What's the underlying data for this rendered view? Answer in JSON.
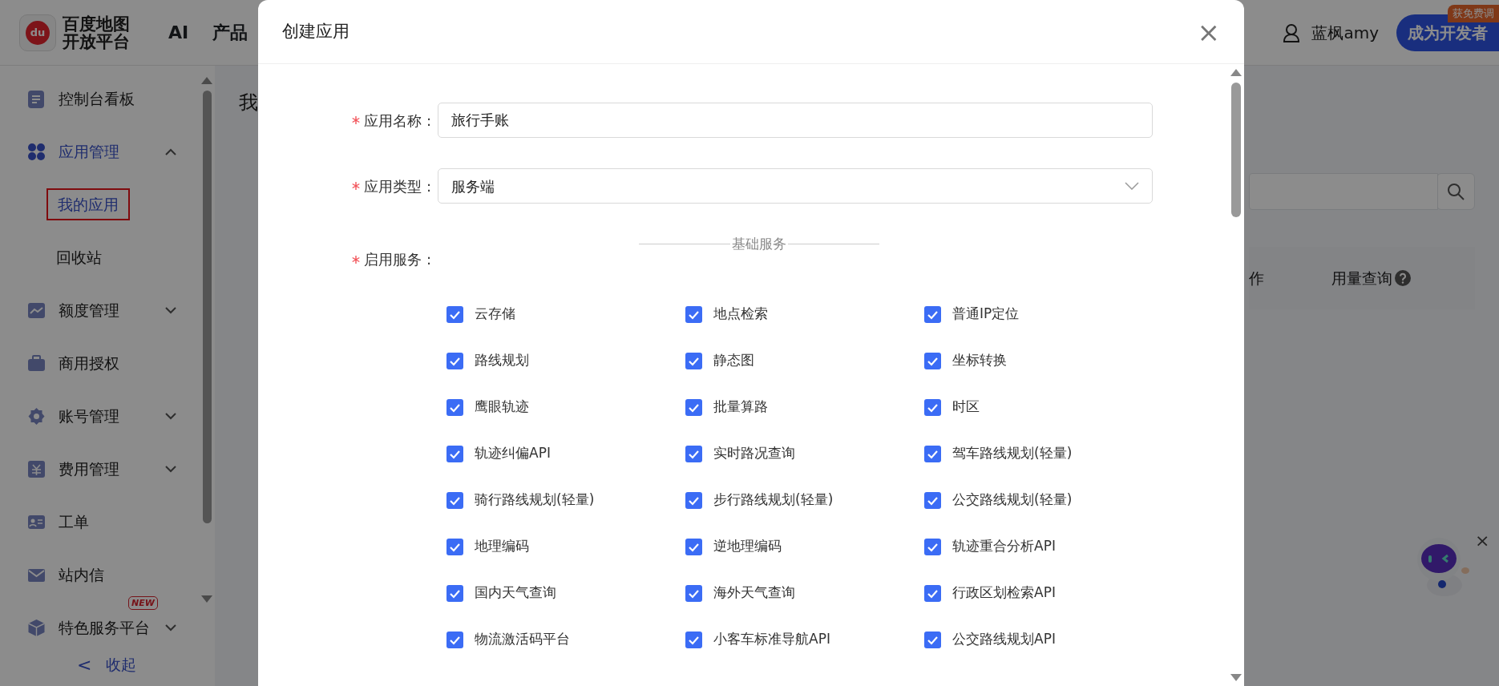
{
  "header": {
    "logo_mark": "du",
    "logo_lines": [
      "百度地图",
      "开放平台"
    ],
    "nav": [
      "AI",
      "产品"
    ],
    "user": "蓝枫amy",
    "cta": "成为开发者",
    "promo": "获免费调"
  },
  "sidebar": {
    "items": [
      {
        "label": "控制台看板",
        "selected": false
      },
      {
        "label": "应用管理",
        "selected": true,
        "expanded": true,
        "children": [
          {
            "label": "我的应用",
            "selected": true
          },
          {
            "label": "回收站",
            "selected": false
          }
        ]
      },
      {
        "label": "额度管理",
        "selected": false,
        "expanded": false
      },
      {
        "label": "商用授权",
        "selected": false
      },
      {
        "label": "账号管理",
        "selected": false,
        "expanded": false
      },
      {
        "label": "费用管理",
        "selected": false,
        "expanded": false
      },
      {
        "label": "工单",
        "selected": false
      },
      {
        "label": "站内信",
        "selected": false
      },
      {
        "label": "特色服务平台",
        "selected": false,
        "expanded": false,
        "badge": "NEW"
      }
    ],
    "collapse": {
      "arrow": "<",
      "label": "收起"
    }
  },
  "page": {
    "title": "我",
    "columns": [
      "作",
      "用量查询"
    ]
  },
  "modal": {
    "title": "创建应用",
    "close": "×",
    "fields": [
      {
        "label": "应用名称 :",
        "required": true,
        "kind": "text",
        "value": "旅行手账"
      },
      {
        "label": "应用类型 :",
        "required": true,
        "kind": "select",
        "value": "服务端"
      }
    ],
    "services": {
      "label": "启用服务 :",
      "required": true,
      "section": "基础服务",
      "items": [
        {
          "label": "云存储",
          "checked": true
        },
        {
          "label": "地点检索",
          "checked": true
        },
        {
          "label": "普通IP定位",
          "checked": true
        },
        {
          "label": "路线规划",
          "checked": true
        },
        {
          "label": "静态图",
          "checked": true
        },
        {
          "label": "坐标转换",
          "checked": true
        },
        {
          "label": "鹰眼轨迹",
          "checked": true
        },
        {
          "label": "批量算路",
          "checked": true
        },
        {
          "label": "时区",
          "checked": true
        },
        {
          "label": "轨迹纠偏API",
          "checked": true
        },
        {
          "label": "实时路况查询",
          "checked": true
        },
        {
          "label": "驾车路线规划(轻量)",
          "checked": true
        },
        {
          "label": "骑行路线规划(轻量)",
          "checked": true
        },
        {
          "label": "步行路线规划(轻量)",
          "checked": true
        },
        {
          "label": "公交路线规划(轻量)",
          "checked": true
        },
        {
          "label": "地理编码",
          "checked": true
        },
        {
          "label": "逆地理编码",
          "checked": true
        },
        {
          "label": "轨迹重合分析API",
          "checked": true
        },
        {
          "label": "国内天气查询",
          "checked": true
        },
        {
          "label": "海外天气查询",
          "checked": true
        },
        {
          "label": "行政区划检索API",
          "checked": true
        },
        {
          "label": "物流激活码平台",
          "checked": true
        },
        {
          "label": "小客车标准导航API",
          "checked": true
        },
        {
          "label": "公交路线规划API",
          "checked": true
        }
      ]
    }
  },
  "assistant": {
    "close": "×"
  }
}
